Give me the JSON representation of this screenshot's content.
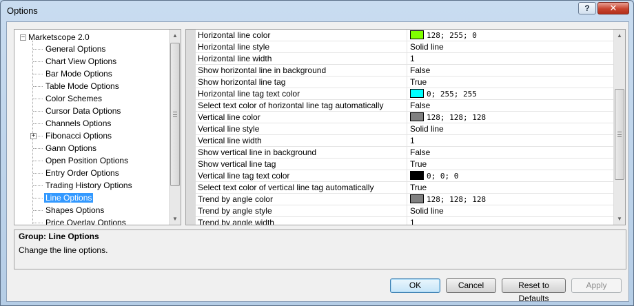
{
  "window": {
    "title": "Options",
    "help_label": "?",
    "close_label": "✕"
  },
  "tree": {
    "root_label": "Marketscope 2.0",
    "root_expander": "−",
    "items": [
      {
        "label": "General Options"
      },
      {
        "label": "Chart View Options"
      },
      {
        "label": "Bar Mode Options"
      },
      {
        "label": "Table Mode Options"
      },
      {
        "label": "Color Schemes"
      },
      {
        "label": "Cursor Data Options"
      },
      {
        "label": "Channels Options"
      },
      {
        "label": "Fibonacci Options",
        "expander": "+"
      },
      {
        "label": "Gann Options"
      },
      {
        "label": "Open Position Options"
      },
      {
        "label": "Entry Order Options"
      },
      {
        "label": "Trading History Options"
      },
      {
        "label": "Line Options",
        "selected": true
      },
      {
        "label": "Shapes Options"
      },
      {
        "label": "Price Overlay Options"
      }
    ]
  },
  "properties": [
    {
      "name": "Horizontal line color",
      "value": "128; 255; 0",
      "color": "#80ff00"
    },
    {
      "name": "Horizontal line style",
      "value": "Solid line"
    },
    {
      "name": "Horizontal line width",
      "value": "1"
    },
    {
      "name": "Show horizontal line in background",
      "value": "False"
    },
    {
      "name": "Show horizontal line tag",
      "value": "True"
    },
    {
      "name": "Horizontal line tag text color",
      "value": "0; 255; 255",
      "color": "#00ffff"
    },
    {
      "name": "Select text color of horizontal line tag automatically",
      "value": "False"
    },
    {
      "name": "Vertical line color",
      "value": "128; 128; 128",
      "color": "#808080"
    },
    {
      "name": "Vertical line style",
      "value": "Solid line"
    },
    {
      "name": "Vertical line width",
      "value": "1"
    },
    {
      "name": "Show vertical line in background",
      "value": "False"
    },
    {
      "name": "Show vertical line tag",
      "value": "True"
    },
    {
      "name": "Vertical line tag text color",
      "value": "0; 0; 0",
      "color": "#000000"
    },
    {
      "name": "Select text color of vertical line tag automatically",
      "value": "True"
    },
    {
      "name": "Trend by angle color",
      "value": "128; 128; 128",
      "color": "#808080"
    },
    {
      "name": "Trend by angle style",
      "value": "Solid line"
    },
    {
      "name": "Trend by angle width",
      "value": "1"
    }
  ],
  "description": {
    "title": "Group: Line Options",
    "text": "Change the line options."
  },
  "buttons": {
    "ok": "OK",
    "cancel": "Cancel",
    "reset": "Reset to Defaults",
    "apply": "Apply"
  },
  "scroll_icons": {
    "up": "▲",
    "down": "▼"
  }
}
